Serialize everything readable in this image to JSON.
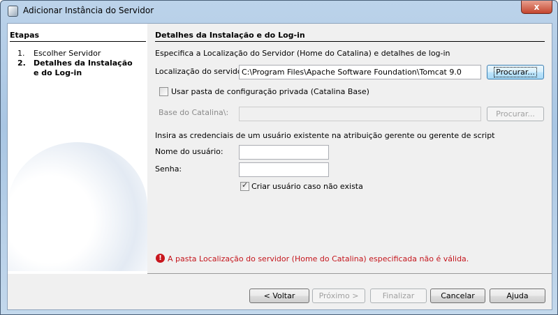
{
  "window": {
    "title": "Adicionar Instância do Servidor",
    "close_label": "x"
  },
  "steps": {
    "heading": "Etapas",
    "items": [
      {
        "num": "1.",
        "label": "Escolher Servidor"
      },
      {
        "num": "2.",
        "label": "Detalhes da Instalação e do Log-in"
      }
    ]
  },
  "main": {
    "heading": "Detalhes da Instalação e do Log-in",
    "description": "Especifica a Localização do Servidor (Home do Catalina) e detalhes de log-in",
    "location_label": "Localização do servidor:",
    "location_value": "C:\\Program Files\\Apache Software Foundation\\Tomcat 9.0",
    "browse_label": "Procurar...",
    "private_config_label": "Usar pasta de configuração privada (Catalina Base)",
    "private_config_checked": false,
    "base_label": "Base do Catalina\\:",
    "base_value": "",
    "base_browse_label": "Procurar...",
    "credentials_text": "Insira as credenciais de um usuário existente na atribuição gerente ou gerente de script",
    "username_label": "Nome do usuário:",
    "username_value": "",
    "password_label": "Senha:",
    "password_value": "",
    "create_user_label": "Criar usuário caso não exista",
    "create_user_checked": true,
    "error": "A pasta Localização do servidor (Home do Catalina) especificada não é válida.",
    "error_color": "#c4151c"
  },
  "buttons": {
    "back": "< Voltar",
    "next": "Próximo >",
    "finish": "Finalizar",
    "cancel": "Cancelar",
    "help": "Ajuda"
  }
}
